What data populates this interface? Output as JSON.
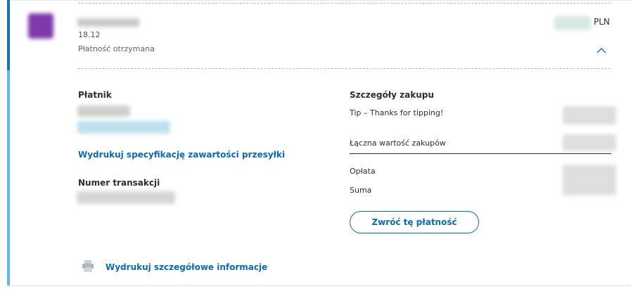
{
  "transaction": {
    "date": "18.12",
    "status": "Płatność otrzymana",
    "currency": "PLN"
  },
  "left": {
    "payer_heading": "Płatnik",
    "print_packing_slip_link": "Wydrukuj specyfikację zawartości przesyłki",
    "transaction_number_heading": "Numer transakcji",
    "print_details_link": "Wydrukuj szczegółowe informacje"
  },
  "right": {
    "purchase_details_heading": "Szczegóły zakupu",
    "item_tip": "Tip – Thanks for tipping!",
    "total_purchase_label": "Łączna wartość zakupów",
    "fee_label": "Opłata",
    "sum_label": "Suma",
    "refund_button": "Zwróć tę płatność"
  },
  "icons": {
    "expand_toggle": "chevron-up-icon",
    "print": "printer-icon"
  },
  "colors": {
    "accent": "#0b6bb3",
    "accent_bar_dark": "#1c6fb6",
    "accent_bar_light": "#5ab7e6"
  }
}
